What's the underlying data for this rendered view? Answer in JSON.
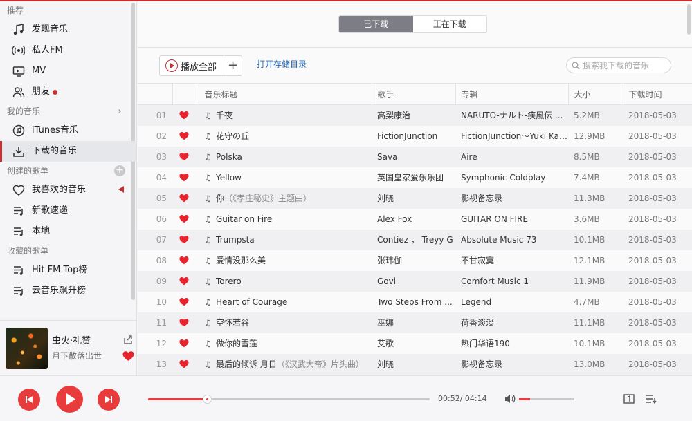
{
  "sidebar": {
    "sections": [
      {
        "title": "推荐",
        "items": [
          {
            "label": "发现音乐",
            "icon": "music-note-icon"
          },
          {
            "label": "私人FM",
            "icon": "radio-icon"
          },
          {
            "label": "MV",
            "icon": "tv-icon"
          },
          {
            "label": "朋友",
            "icon": "friends-icon",
            "badge": true
          }
        ]
      },
      {
        "title": "我的音乐",
        "items": [
          {
            "label": "iTunes音乐",
            "icon": "itunes-icon"
          },
          {
            "label": "下载的音乐",
            "icon": "download-icon",
            "active": true
          }
        ]
      },
      {
        "title": "创建的歌单",
        "items": [
          {
            "label": "我喜欢的音乐",
            "icon": "heart-outline-icon",
            "playing": true
          },
          {
            "label": "新歌速递",
            "icon": "playlist-icon"
          },
          {
            "label": "本地",
            "icon": "playlist-icon"
          }
        ]
      },
      {
        "title": "收藏的歌单",
        "items": [
          {
            "label": "Hit FM Top榜",
            "icon": "playlist-icon"
          },
          {
            "label": "云音乐飙升榜",
            "icon": "playlist-icon"
          }
        ]
      }
    ]
  },
  "now_playing": {
    "title": "虫火·礼赞",
    "artist": "月下散落出世"
  },
  "tabs": [
    {
      "label": "已下载",
      "active": true
    },
    {
      "label": "正在下载",
      "active": false
    }
  ],
  "toolbar": {
    "play_all": "播放全部",
    "add": "+",
    "open_dir": "打开存储目录",
    "search_placeholder": "搜索我下载的音乐"
  },
  "table": {
    "headers": [
      "",
      "",
      "音乐标题",
      "歌手",
      "专辑",
      "大小",
      "下载时间"
    ],
    "rows": [
      {
        "idx": "01",
        "title": "千夜",
        "sub": "",
        "artist": "高梨康治",
        "album": "NARUTO-ナルト-疾風伝 ...",
        "size": "5.2MB",
        "date": "2018-05-03"
      },
      {
        "idx": "02",
        "title": "花守の丘",
        "sub": "",
        "artist": "FictionJunction",
        "album": "FictionJunction～Yuki Kaj...",
        "size": "12.9MB",
        "date": "2018-05-03"
      },
      {
        "idx": "03",
        "title": "Polska",
        "sub": "",
        "artist": "Sava",
        "album": "Aire",
        "size": "8.5MB",
        "date": "2018-05-03"
      },
      {
        "idx": "04",
        "title": "Yellow",
        "sub": "",
        "artist": "英国皇家爱乐乐团",
        "album": "Symphonic Coldplay",
        "size": "7.4MB",
        "date": "2018-05-03"
      },
      {
        "idx": "05",
        "title": "你",
        "sub": "（《孝庄秘史》主题曲）",
        "artist": "刘晓",
        "album": "影视备忘录",
        "size": "11.3MB",
        "date": "2018-05-03"
      },
      {
        "idx": "06",
        "title": "Guitar on Fire",
        "sub": "",
        "artist": "Alex Fox",
        "album": "GUITAR ON FIRE",
        "size": "3.6MB",
        "date": "2018-05-03"
      },
      {
        "idx": "07",
        "title": "Trumpsta",
        "sub": "",
        "artist": "Contiez ， Treyy G",
        "album": "Absolute Music 73",
        "size": "10.1MB",
        "date": "2018-05-03"
      },
      {
        "idx": "08",
        "title": "爱情没那么美",
        "sub": "",
        "artist": "张玮伽",
        "album": "不甘寂寞",
        "size": "12.1MB",
        "date": "2018-05-03"
      },
      {
        "idx": "09",
        "title": "Torero",
        "sub": "",
        "artist": "Govi",
        "album": "Comfort Music 1",
        "size": "11.9MB",
        "date": "2018-05-03"
      },
      {
        "idx": "10",
        "title": "Heart of Courage",
        "sub": "",
        "artist": "Two Steps From ...",
        "album": "Legend",
        "size": "4.7MB",
        "date": "2018-05-03"
      },
      {
        "idx": "11",
        "title": "空怀若谷",
        "sub": "",
        "artist": "巫娜",
        "album": "荷香淡淡",
        "size": "11.1MB",
        "date": "2018-05-03"
      },
      {
        "idx": "12",
        "title": "做你的雪莲",
        "sub": "",
        "artist": "艾歌",
        "album": "热门华语190",
        "size": "10.1MB",
        "date": "2018-05-03"
      },
      {
        "idx": "13",
        "title": "最后的倾诉 月日",
        "sub": "（《汉武大帝》片头曲）",
        "artist": "刘晓",
        "album": "影视备忘录",
        "size": "13.0MB",
        "date": "2018-05-03"
      }
    ]
  },
  "player": {
    "current": "00:52",
    "total": "04:14",
    "progress": 0.21,
    "volume": 0.2
  },
  "colors": {
    "accent": "#c62f2f",
    "player_red": "#e83c3c",
    "link": "#2b6cb8"
  }
}
